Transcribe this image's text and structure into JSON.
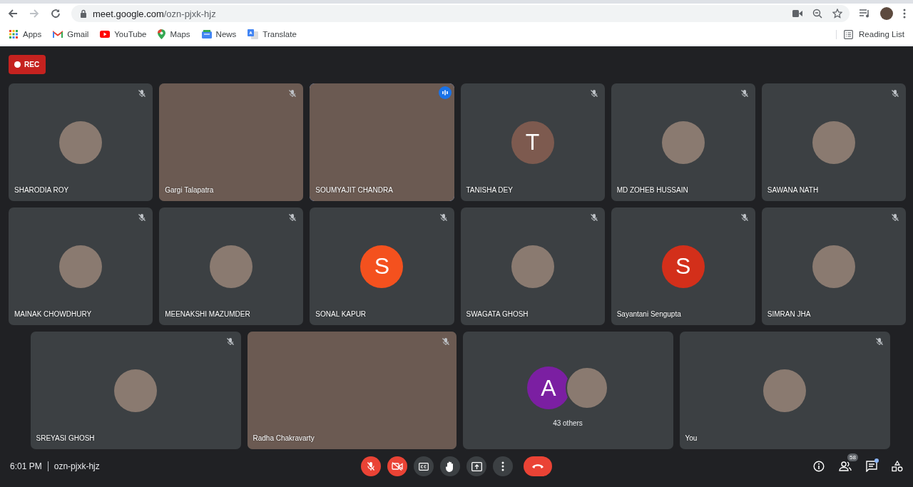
{
  "browser": {
    "url_host": "meet.google.com",
    "url_path": "/ozn-pjxk-hjz",
    "forward_disabled": true,
    "bookmarks": [
      {
        "label": "Apps",
        "kind": "apps"
      },
      {
        "label": "Gmail",
        "kind": "gmail"
      },
      {
        "label": "YouTube",
        "kind": "youtube"
      },
      {
        "label": "Maps",
        "kind": "maps"
      },
      {
        "label": "News",
        "kind": "news"
      },
      {
        "label": "Translate",
        "kind": "translate"
      }
    ],
    "reading_list": "Reading List"
  },
  "recording": {
    "label": "REC"
  },
  "tiles": [
    {
      "name": "SHARODIA ROY",
      "kind": "avatar",
      "muted": true,
      "speaking": false
    },
    {
      "name": "Gargi Talapatra",
      "kind": "video",
      "muted": true,
      "speaking": false
    },
    {
      "name": "SOUMYAJIT CHANDRA",
      "kind": "video",
      "muted": false,
      "speaking": true
    },
    {
      "name": "TANISHA DEY",
      "kind": "letter",
      "letter": "T",
      "color": "#7d5a4f",
      "muted": true,
      "speaking": false
    },
    {
      "name": "MD ZOHEB HUSSAIN",
      "kind": "avatar",
      "muted": true,
      "speaking": false
    },
    {
      "name": "SAWANA NATH",
      "kind": "avatar",
      "muted": true,
      "speaking": false
    },
    {
      "name": "MAINAK CHOWDHURY",
      "kind": "avatar",
      "muted": true,
      "speaking": false
    },
    {
      "name": "MEENAKSHI MAZUMDER",
      "kind": "avatar",
      "muted": true,
      "speaking": false
    },
    {
      "name": "SONAL KAPUR",
      "kind": "letter",
      "letter": "S",
      "color": "#f4511e",
      "muted": true,
      "speaking": false
    },
    {
      "name": "SWAGATA GHOSH",
      "kind": "avatar",
      "muted": true,
      "speaking": false
    },
    {
      "name": "Sayantani Sengupta",
      "kind": "letter",
      "letter": "S",
      "color": "#d32f1a",
      "muted": true,
      "speaking": false
    },
    {
      "name": "SIMRAN JHA",
      "kind": "avatar",
      "muted": true,
      "speaking": false
    },
    {
      "name": "SREYASI GHOSH",
      "kind": "avatar",
      "muted": true,
      "speaking": false
    },
    {
      "name": "Radha Chakravarty",
      "kind": "video",
      "muted": true,
      "speaking": false
    },
    {
      "name": "43 others",
      "kind": "group",
      "letter": "A",
      "color": "#7b1fa2",
      "muted": false,
      "speaking": false
    },
    {
      "name": "You",
      "kind": "avatar",
      "muted": true,
      "speaking": false
    }
  ],
  "bottom_bar": {
    "time": "6:01 PM",
    "meeting_code": "ozn-pjxk-hjz",
    "mic_on": false,
    "camera_on": false,
    "people_count": "58",
    "chat_unread": true
  }
}
